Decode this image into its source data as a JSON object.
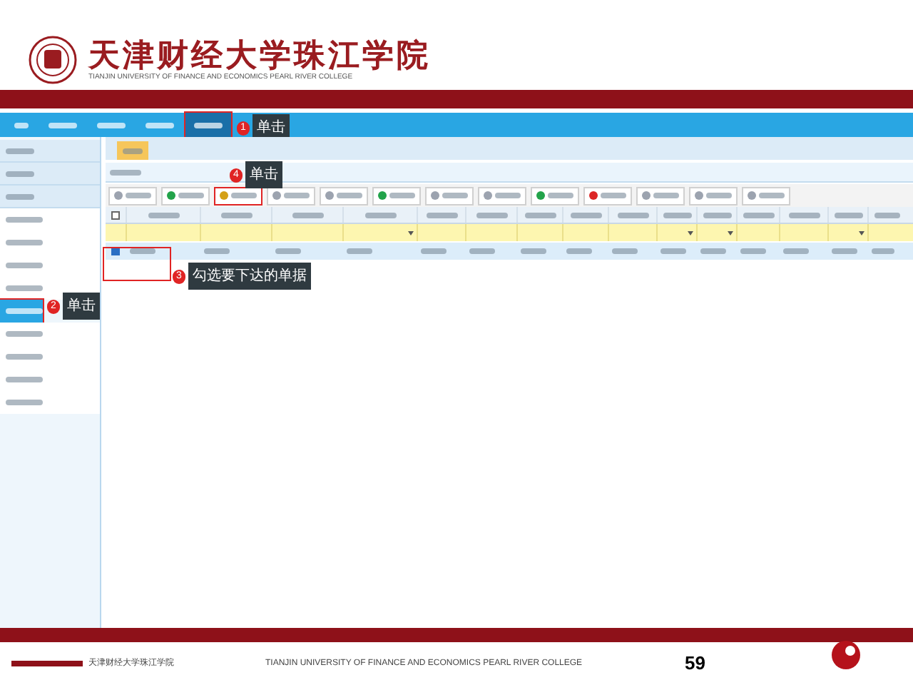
{
  "header": {
    "title": "天津财经大学珠江学院",
    "subtitle": "TIANJIN UNIVERSITY OF FINANCE AND ECONOMICS PEARL RIVER COLLEGE"
  },
  "nav": {
    "items": [
      {
        "selected": false
      },
      {
        "selected": false
      },
      {
        "selected": false
      },
      {
        "selected": false
      },
      {
        "selected": true
      }
    ],
    "callout": {
      "number": "1",
      "text": "单击"
    }
  },
  "sidebar": {
    "items": [
      {
        "kind": "group",
        "selected": false
      },
      {
        "kind": "group",
        "selected": false
      },
      {
        "kind": "group",
        "selected": false
      },
      {
        "kind": "item",
        "selected": false
      },
      {
        "kind": "item",
        "selected": false
      },
      {
        "kind": "item",
        "selected": false
      },
      {
        "kind": "item",
        "selected": false
      },
      {
        "kind": "item",
        "selected": true
      },
      {
        "kind": "item",
        "selected": false
      },
      {
        "kind": "item",
        "selected": false
      },
      {
        "kind": "item",
        "selected": false
      },
      {
        "kind": "item",
        "selected": false
      }
    ],
    "callout": {
      "number": "2",
      "text": "单击"
    }
  },
  "toolbar": {
    "buttons": [
      {
        "color": "#9ca3af",
        "highlighted": false
      },
      {
        "color": "#22a34a",
        "highlighted": false
      },
      {
        "color": "#d4a017",
        "highlighted": true
      },
      {
        "color": "#9ca3af",
        "highlighted": false
      },
      {
        "color": "#9ca3af",
        "highlighted": false
      },
      {
        "color": "#22a34a",
        "highlighted": false
      },
      {
        "color": "#9ca3af",
        "highlighted": false
      },
      {
        "color": "#9ca3af",
        "highlighted": false
      },
      {
        "color": "#22a34a",
        "highlighted": false
      },
      {
        "color": "#dc2626",
        "highlighted": false
      },
      {
        "color": "#9ca3af",
        "highlighted": false
      },
      {
        "color": "#9ca3af",
        "highlighted": false
      },
      {
        "color": "#9ca3af",
        "highlighted": false
      }
    ],
    "callout": {
      "number": "4",
      "text": "单击"
    }
  },
  "table": {
    "select_all_checked": false,
    "columns": [
      {
        "dropdown": false
      },
      {
        "dropdown": false
      },
      {
        "dropdown": false
      },
      {
        "dropdown": true
      },
      {
        "dropdown": false
      },
      {
        "dropdown": false
      },
      {
        "dropdown": false
      },
      {
        "dropdown": false
      },
      {
        "dropdown": false
      },
      {
        "dropdown": true
      },
      {
        "dropdown": true
      },
      {
        "dropdown": false
      },
      {
        "dropdown": false
      },
      {
        "dropdown": true
      },
      {
        "dropdown": false
      }
    ],
    "rows": [
      {
        "checked": true,
        "highlighted": true
      }
    ],
    "callout": {
      "number": "3",
      "text": "勾选要下达的单据"
    }
  },
  "footer": {
    "title": "天津财经大学珠江学院",
    "subtitle": "TIANJIN UNIVERSITY OF FINANCE AND ECONOMICS PEARL RIVER COLLEGE",
    "page": "59"
  }
}
